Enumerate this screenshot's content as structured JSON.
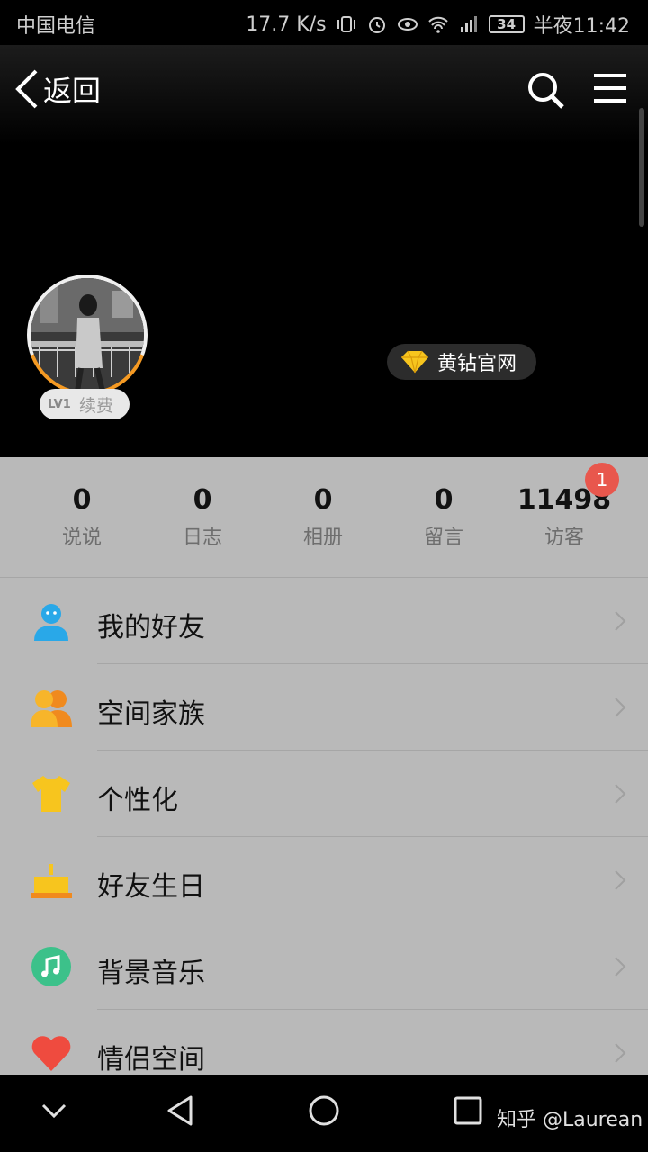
{
  "status_bar": {
    "carrier": "中国电信",
    "speed": "17.7 K/s",
    "network": "4G",
    "battery": "34",
    "time": "半夜11:42"
  },
  "header": {
    "back_label": "返回",
    "icons": [
      "chevron-left-icon",
      "search-icon",
      "menu-icon"
    ]
  },
  "profile": {
    "level": "LV1",
    "renew_label": "续费",
    "vip_label": "黄钻官网"
  },
  "stats": [
    {
      "value": "0",
      "label": "说说"
    },
    {
      "value": "0",
      "label": "日志"
    },
    {
      "value": "0",
      "label": "相册"
    },
    {
      "value": "0",
      "label": "留言"
    },
    {
      "value": "11498",
      "label": "访客",
      "badge": "1"
    }
  ],
  "menu": [
    {
      "label": "我的好友",
      "icon": "friends-icon",
      "color": "#29a8e8"
    },
    {
      "label": "空间家族",
      "icon": "family-icon",
      "color": "#f5a623"
    },
    {
      "label": "个性化",
      "icon": "tshirt-icon",
      "color": "#f7c51e"
    },
    {
      "label": "好友生日",
      "icon": "cake-icon",
      "color": "#f5a623"
    },
    {
      "label": "背景音乐",
      "icon": "music-icon",
      "color": "#3cc18a"
    },
    {
      "label": "情侣空间",
      "icon": "heart-icon",
      "color": "#ef4b3f"
    }
  ],
  "navbar": {
    "watermark": "知乎 @Laurean"
  }
}
